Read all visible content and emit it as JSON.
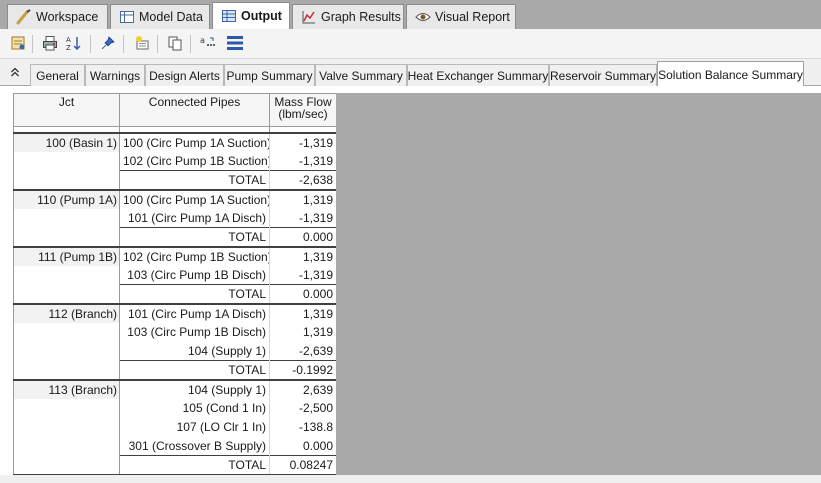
{
  "main_tabs": [
    {
      "label": "Workspace",
      "icon": "workspace-icon",
      "active": false
    },
    {
      "label": "Model Data",
      "icon": "model-data-icon",
      "active": false
    },
    {
      "label": "Output",
      "icon": "output-icon",
      "active": true
    },
    {
      "label": "Graph Results",
      "icon": "graph-icon",
      "active": false
    },
    {
      "label": "Visual Report",
      "icon": "eye-icon",
      "active": false
    }
  ],
  "toolbar": {
    "icons": [
      "output-control-icon",
      "print-icon",
      "sort-icon",
      "pin-icon",
      "highlight-icon",
      "copy-icon",
      "formatting-icon",
      "sections-icon"
    ]
  },
  "sub_tabs": [
    {
      "label": "General",
      "active": false
    },
    {
      "label": "Warnings",
      "active": false
    },
    {
      "label": "Design Alerts",
      "active": false
    },
    {
      "label": "Pump Summary",
      "active": false
    },
    {
      "label": "Valve Summary",
      "active": false
    },
    {
      "label": "Heat Exchanger Summary",
      "active": false
    },
    {
      "label": "Reservoir Summary",
      "active": false
    },
    {
      "label": "Solution Balance Summary",
      "active": true
    }
  ],
  "table": {
    "headers": {
      "jct": "Jct",
      "pipes": "Connected Pipes",
      "flow_line1": "Mass Flow",
      "flow_line2": "(lbm/sec)"
    },
    "groups": [
      {
        "jct": "100 (Basin 1)",
        "rows": [
          {
            "pipe": "100 (Circ Pump 1A Suction)",
            "flow": "-1,319"
          },
          {
            "pipe": "102 (Circ Pump 1B Suction)",
            "flow": "-1,319"
          },
          {
            "pipe": "TOTAL",
            "flow": "-2,638",
            "total": true
          }
        ]
      },
      {
        "jct": "110 (Pump 1A)",
        "rows": [
          {
            "pipe": "100 (Circ Pump 1A Suction)",
            "flow": "1,319"
          },
          {
            "pipe": "101 (Circ Pump 1A Disch)",
            "flow": "-1,319"
          },
          {
            "pipe": "TOTAL",
            "flow": "0.000",
            "total": true
          }
        ]
      },
      {
        "jct": "111 (Pump 1B)",
        "rows": [
          {
            "pipe": "102 (Circ Pump 1B Suction)",
            "flow": "1,319"
          },
          {
            "pipe": "103 (Circ Pump 1B Disch)",
            "flow": "-1,319"
          },
          {
            "pipe": "TOTAL",
            "flow": "0.000",
            "total": true
          }
        ]
      },
      {
        "jct": "112 (Branch)",
        "rows": [
          {
            "pipe": "101 (Circ Pump 1A Disch)",
            "flow": "1,319"
          },
          {
            "pipe": "103 (Circ Pump 1B Disch)",
            "flow": "1,319"
          },
          {
            "pipe": "104 (Supply 1)",
            "flow": "-2,639"
          },
          {
            "pipe": "TOTAL",
            "flow": "-0.1992",
            "total": true
          }
        ]
      },
      {
        "jct": "113 (Branch)",
        "rows": [
          {
            "pipe": "104 (Supply 1)",
            "flow": "2,639"
          },
          {
            "pipe": "105 (Cond 1 In)",
            "flow": "-2,500"
          },
          {
            "pipe": "107 (LO Clr 1 In)",
            "flow": "-138.8"
          },
          {
            "pipe": "301 (Crossover B Supply)",
            "flow": "0.000"
          },
          {
            "pipe": "TOTAL",
            "flow": "0.08247",
            "total": true
          }
        ]
      }
    ]
  }
}
